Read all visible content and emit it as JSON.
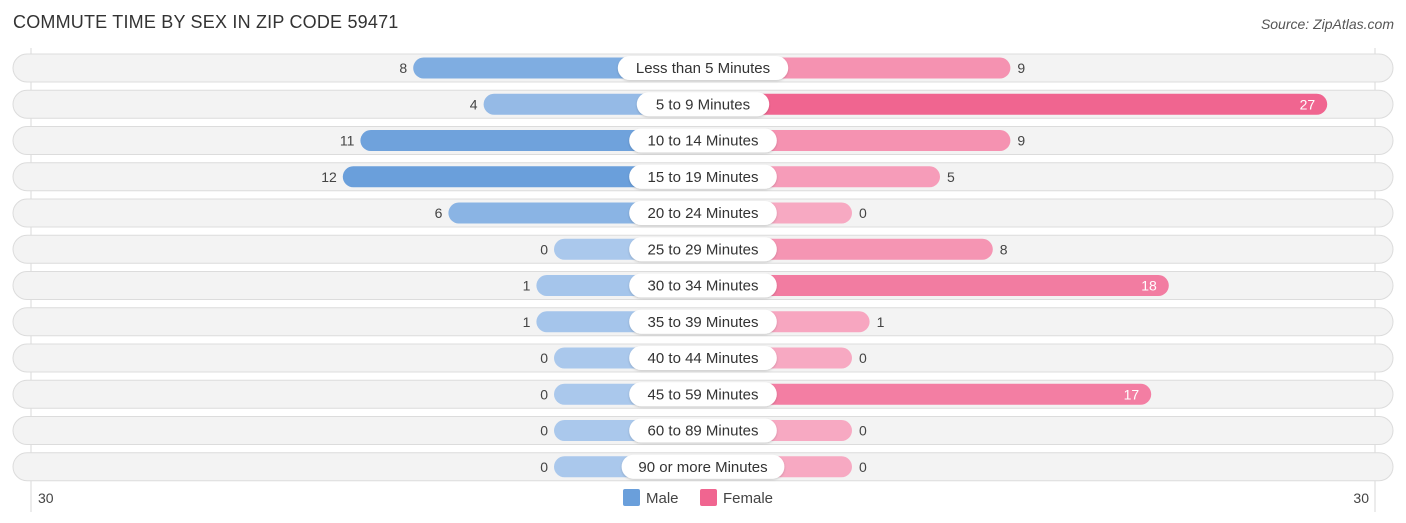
{
  "chart_data": {
    "type": "bar",
    "orientation": "horizontal-diverging",
    "title": "COMMUTE TIME BY SEX IN ZIP CODE 59471",
    "source": "Source: ZipAtlas.com",
    "categories": [
      "Less than 5 Minutes",
      "5 to 9 Minutes",
      "10 to 14 Minutes",
      "15 to 19 Minutes",
      "20 to 24 Minutes",
      "25 to 29 Minutes",
      "30 to 34 Minutes",
      "35 to 39 Minutes",
      "40 to 44 Minutes",
      "45 to 59 Minutes",
      "60 to 89 Minutes",
      "90 or more Minutes"
    ],
    "series": [
      {
        "name": "Male",
        "color": "#6a9fdb",
        "values": [
          8,
          4,
          11,
          12,
          6,
          0,
          1,
          1,
          0,
          0,
          0,
          0
        ]
      },
      {
        "name": "Female",
        "color": "#f06590",
        "values": [
          9,
          27,
          9,
          5,
          0,
          8,
          18,
          1,
          0,
          17,
          0,
          0
        ]
      }
    ],
    "axis_min_label": "30",
    "axis_max_label": "30",
    "xlim": [
      -30,
      30
    ],
    "legend_position": "bottom-center",
    "grid": false
  }
}
